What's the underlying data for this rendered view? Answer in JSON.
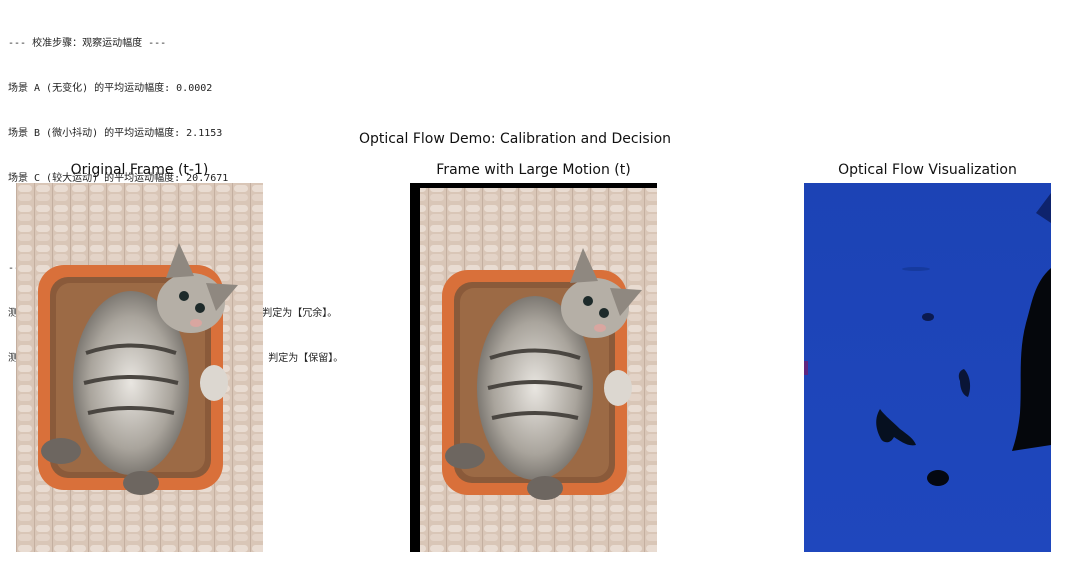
{
  "console": {
    "calibration_header": "--- 校准步骤：观察运动幅度 ---",
    "scene_a": "场景 A (无变化) 的平均运动幅度: 0.0002",
    "scene_b": "场景 B (微小抖动) 的平均运动幅度: 2.1153",
    "scene_c": "场景 C (较大运动) 的平均运动幅度: 20.7671",
    "decision_header": "--- 决策步骤 (使用阈值: 3.0) ---",
    "test_b": "测试场景 B (微小抖动): 幅度为 2.1153，低于阈值，判定为【冗余】。",
    "test_c": "测试场景 C (较大运动): 幅度为 20.7671，高于阈值，判定为【保留】。"
  },
  "figure": {
    "suptitle": "Optical Flow Demo: Calibration and Decision",
    "panels": [
      {
        "title": "Original Frame (t-1)",
        "image": "cat-in-basket-photo"
      },
      {
        "title": "Frame with Large Motion (t)",
        "image": "shifted-cat-in-basket-photo"
      },
      {
        "title": "Optical Flow Visualization",
        "image": "optical-flow-color-map"
      }
    ]
  },
  "colors": {
    "flow_blue": "#1d44b8",
    "basket_orange": "#d9703a",
    "knit_background": "#d8c3b3"
  }
}
